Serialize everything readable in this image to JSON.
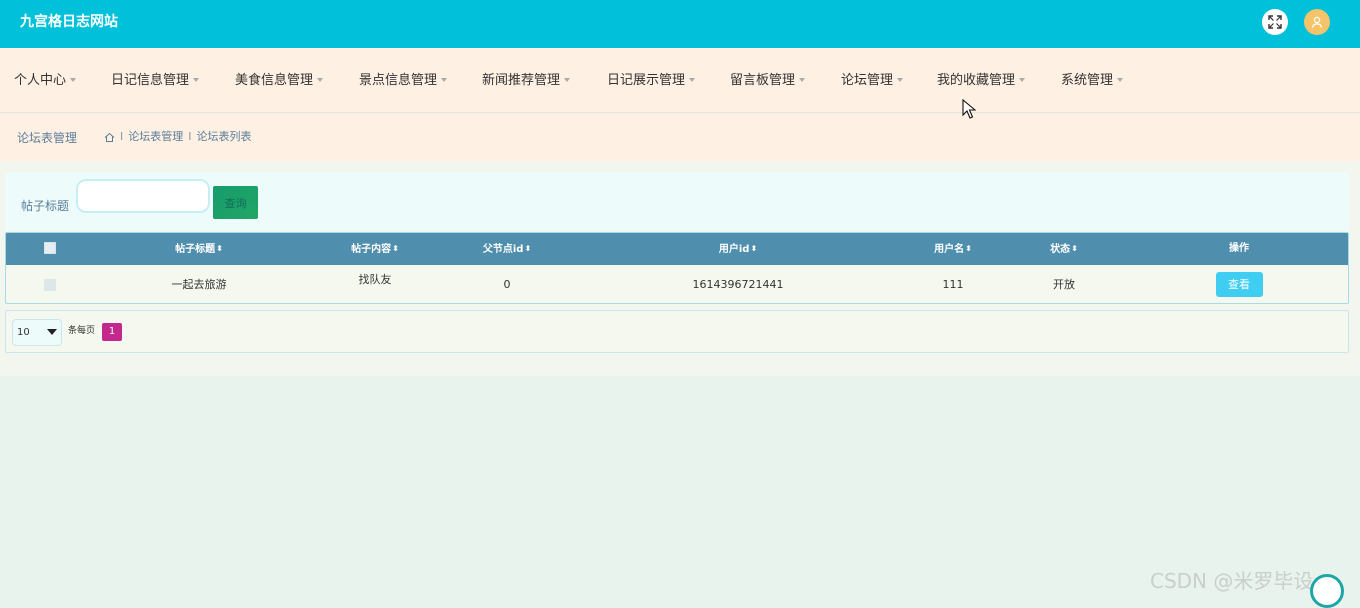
{
  "header": {
    "title": "九宫格日志网站",
    "fullscreen_icon": "fullscreen-icon",
    "avatar_icon": "user-icon"
  },
  "nav": {
    "items": [
      {
        "label": "个人中心"
      },
      {
        "label": "日记信息管理"
      },
      {
        "label": "美食信息管理"
      },
      {
        "label": "景点信息管理"
      },
      {
        "label": "新闻推荐管理"
      },
      {
        "label": "日记展示管理"
      },
      {
        "label": "留言板管理"
      },
      {
        "label": "论坛管理"
      },
      {
        "label": "我的收藏管理"
      },
      {
        "label": "系统管理"
      }
    ]
  },
  "breadcrumb": {
    "section_title": "论坛表管理",
    "home_icon": "home-icon",
    "separator": "I",
    "items": [
      "论坛表管理",
      "论坛表列表"
    ]
  },
  "search": {
    "label": "帖子标题",
    "value": "",
    "placeholder": "",
    "button_label": "查询"
  },
  "table": {
    "sort_glyph": "⬍",
    "columns": [
      "帖子标题",
      "帖子内容",
      "父节点id",
      "用户id",
      "用户名",
      "状态",
      "操作"
    ],
    "rows": [
      {
        "title": "一起去旅游",
        "content": "找队友",
        "parent_id": "0",
        "user_id": "1614396721441",
        "username": "111",
        "status": "开放",
        "action_label": "查看"
      }
    ]
  },
  "pagination": {
    "page_size": "10",
    "per_page_label": "条每页",
    "current_page": "1"
  },
  "watermark": "CSDN @米罗毕设",
  "colors": {
    "topbar": "#00c1d9",
    "navbar": "#fef0e3",
    "table_header": "#4f8ead",
    "search_button": "#169c6e",
    "view_button": "#3fcdf2",
    "active_page": "#c3288c"
  }
}
